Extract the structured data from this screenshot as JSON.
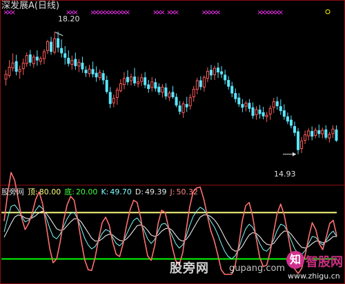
{
  "title": "深发展A(日线)",
  "high_label": "18.20",
  "low_label": "14.93",
  "indicator": {
    "name": "股旁网",
    "top_label": "顶:",
    "top_value": "80.00",
    "bottom_label": "底:",
    "bottom_value": "20.00",
    "k_label": "K:",
    "k_value": "49.70",
    "d_label": "D:",
    "d_value": "49.39",
    "j_label": "J:",
    "j_value": "50.32"
  },
  "watermark": "股旁网",
  "watermark_url": "gupang.com",
  "logo_char": "知",
  "logo_text": "智股网",
  "logo_url": "www.zhigu.cn",
  "colors": {
    "up": "#ff5a5a",
    "down": "#5ae6ff",
    "marker": "#ff33ff",
    "top_line": "#ffff80",
    "bottom_line": "#00ff00",
    "k_line": "#ff7070",
    "d_line": "#80ffff",
    "j_line": "#ffffff"
  },
  "chart_data": [
    {
      "type": "candlestick",
      "title": "深发展A(日线)",
      "ylim": [
        14.3,
        18.6
      ],
      "annotations": [
        {
          "text": "18.20",
          "value": 18.2
        },
        {
          "text": "14.93",
          "value": 14.93
        }
      ],
      "ohlc": [
        [
          16.93,
          17.18,
          16.76,
          17.06
        ],
        [
          17.03,
          17.44,
          16.97,
          17.25
        ],
        [
          17.23,
          17.62,
          17.14,
          17.36
        ],
        [
          17.4,
          17.58,
          17.03,
          17.14
        ],
        [
          17.13,
          17.29,
          16.94,
          17.19
        ],
        [
          17.21,
          17.48,
          17.04,
          17.36
        ],
        [
          17.35,
          17.64,
          17.26,
          17.56
        ],
        [
          17.58,
          17.71,
          17.28,
          17.38
        ],
        [
          17.34,
          17.59,
          17.23,
          17.52
        ],
        [
          17.52,
          17.7,
          17.29,
          17.44
        ],
        [
          17.41,
          17.54,
          17.31,
          17.48
        ],
        [
          17.48,
          17.73,
          17.33,
          17.66
        ],
        [
          17.69,
          17.98,
          17.6,
          17.93
        ],
        [
          17.92,
          18.06,
          17.58,
          17.67
        ],
        [
          17.65,
          18.2,
          17.59,
          18.01
        ],
        [
          18.01,
          18.2,
          17.65,
          17.78
        ],
        [
          17.75,
          17.99,
          17.51,
          17.63
        ],
        [
          17.61,
          17.81,
          17.32,
          17.51
        ],
        [
          17.49,
          17.7,
          17.27,
          17.35
        ],
        [
          17.32,
          17.56,
          17.18,
          17.43
        ],
        [
          17.46,
          17.64,
          17.18,
          17.29
        ],
        [
          17.28,
          17.47,
          17.12,
          17.38
        ],
        [
          17.36,
          17.53,
          17.1,
          17.2
        ],
        [
          17.17,
          17.28,
          16.99,
          17.1
        ],
        [
          17.08,
          17.31,
          16.99,
          17.2
        ],
        [
          17.19,
          17.4,
          16.98,
          17.07
        ],
        [
          17.09,
          17.27,
          16.86,
          16.99
        ],
        [
          16.97,
          17.19,
          16.9,
          17.11
        ],
        [
          17.08,
          17.17,
          16.79,
          16.91
        ],
        [
          16.9,
          17.02,
          16.54,
          16.6
        ],
        [
          16.58,
          16.72,
          16.16,
          16.28
        ],
        [
          16.3,
          16.52,
          16.18,
          16.42
        ],
        [
          16.44,
          16.71,
          16.25,
          16.64
        ],
        [
          16.62,
          16.93,
          16.58,
          16.81
        ],
        [
          16.79,
          17.12,
          16.66,
          16.95
        ],
        [
          16.98,
          17.17,
          16.77,
          16.86
        ],
        [
          16.89,
          17.08,
          16.76,
          16.99
        ],
        [
          16.99,
          17.23,
          16.75,
          16.83
        ],
        [
          16.81,
          17.0,
          16.71,
          16.86
        ],
        [
          16.87,
          17.08,
          16.75,
          16.97
        ],
        [
          16.97,
          17.12,
          16.69,
          16.78
        ],
        [
          16.78,
          16.91,
          16.57,
          16.68
        ],
        [
          16.71,
          16.99,
          16.6,
          16.86
        ],
        [
          16.84,
          16.95,
          16.6,
          16.69
        ],
        [
          16.72,
          16.82,
          16.51,
          16.59
        ],
        [
          16.58,
          16.8,
          16.44,
          16.72
        ],
        [
          16.7,
          16.82,
          16.39,
          16.48
        ],
        [
          16.45,
          16.62,
          16.35,
          16.56
        ],
        [
          16.58,
          16.75,
          16.41,
          16.46
        ],
        [
          16.45,
          16.55,
          16.18,
          16.24
        ],
        [
          16.22,
          16.35,
          15.99,
          16.07
        ],
        [
          16.04,
          16.34,
          15.9,
          16.27
        ],
        [
          16.26,
          16.46,
          16.06,
          16.19
        ],
        [
          16.22,
          16.53,
          16.12,
          16.44
        ],
        [
          16.46,
          16.75,
          16.33,
          16.66
        ],
        [
          16.66,
          16.97,
          16.53,
          16.89
        ],
        [
          16.89,
          17.01,
          16.64,
          16.73
        ],
        [
          16.72,
          17.03,
          16.6,
          16.98
        ],
        [
          16.95,
          17.25,
          16.85,
          17.14
        ],
        [
          17.17,
          17.31,
          16.91,
          17.04
        ],
        [
          17.05,
          17.29,
          16.91,
          17.22
        ],
        [
          17.23,
          17.37,
          16.96,
          17.12
        ],
        [
          17.13,
          17.28,
          16.96,
          17.07
        ],
        [
          17.04,
          17.18,
          16.79,
          16.91
        ],
        [
          16.9,
          17.01,
          16.65,
          16.74
        ],
        [
          16.74,
          16.86,
          16.45,
          16.56
        ],
        [
          16.55,
          16.68,
          16.31,
          16.41
        ],
        [
          16.43,
          16.56,
          16.19,
          16.27
        ],
        [
          16.26,
          16.4,
          16.05,
          16.18
        ],
        [
          16.21,
          16.35,
          16.07,
          16.29
        ],
        [
          16.29,
          16.4,
          16.05,
          16.15
        ],
        [
          16.17,
          16.31,
          15.87,
          15.96
        ],
        [
          15.98,
          16.21,
          15.85,
          16.12
        ],
        [
          16.11,
          16.24,
          15.88,
          16.01
        ],
        [
          16.04,
          16.19,
          15.86,
          15.95
        ],
        [
          15.93,
          16.06,
          15.79,
          15.97
        ],
        [
          16.0,
          16.23,
          15.85,
          16.15
        ],
        [
          16.18,
          16.43,
          16.03,
          16.33
        ],
        [
          16.33,
          16.46,
          16.12,
          16.22
        ],
        [
          16.2,
          16.39,
          15.98,
          16.09
        ],
        [
          16.09,
          16.26,
          15.85,
          15.94
        ],
        [
          15.93,
          16.04,
          15.73,
          15.81
        ],
        [
          15.84,
          15.96,
          15.62,
          15.7
        ],
        [
          15.67,
          15.8,
          15.41,
          15.51
        ],
        [
          15.53,
          15.63,
          14.93,
          15.05
        ],
        [
          15.08,
          15.39,
          14.96,
          15.28
        ],
        [
          15.3,
          15.56,
          15.2,
          15.45
        ],
        [
          15.42,
          15.62,
          15.3,
          15.55
        ],
        [
          15.54,
          15.67,
          15.3,
          15.41
        ],
        [
          15.43,
          15.64,
          15.36,
          15.57
        ],
        [
          15.56,
          15.72,
          15.37,
          15.48
        ],
        [
          15.47,
          15.64,
          15.35,
          15.57
        ],
        [
          15.58,
          15.7,
          15.32,
          15.38
        ],
        [
          15.36,
          15.52,
          15.24,
          15.46
        ],
        [
          15.48,
          15.7,
          15.36,
          15.6
        ],
        [
          15.58,
          15.7,
          15.26,
          15.3
        ]
      ],
      "markers": [
        {
          "label": "×",
          "start": 0,
          "end": 2
        },
        {
          "label": "×",
          "start": 18,
          "end": 20
        },
        {
          "label": "×",
          "start": 25,
          "end": 35
        },
        {
          "label": "×",
          "start": 43,
          "end": 45
        },
        {
          "label": "×",
          "start": 47,
          "end": 49
        },
        {
          "label": "×",
          "start": 57,
          "end": 61
        },
        {
          "label": "×",
          "start": 73,
          "end": 79
        }
      ]
    },
    {
      "type": "line",
      "title": "股旁网",
      "ylim": [
        0,
        100
      ],
      "reference_lines": [
        {
          "name": "顶",
          "value": 80
        },
        {
          "name": "底",
          "value": 20
        }
      ],
      "series": [
        {
          "name": "K",
          "values": [
            55,
            73,
            88,
            90,
            84,
            75,
            68,
            70,
            75,
            83,
            89,
            85,
            74,
            60,
            49,
            46,
            52,
            62,
            72,
            79,
            80,
            72,
            60,
            47,
            38,
            33,
            36,
            44,
            53,
            58,
            56,
            48,
            40,
            37,
            42,
            52,
            62,
            70,
            73,
            67,
            57,
            46,
            40,
            45,
            56,
            65,
            66,
            60,
            50,
            40,
            34,
            38,
            49,
            63,
            75,
            82,
            87,
            84,
            77,
            69,
            62,
            52,
            40,
            30,
            23,
            20,
            24,
            33,
            47,
            59,
            65,
            61,
            51,
            40,
            32,
            30,
            35,
            45,
            57,
            65,
            63,
            55,
            44,
            33,
            27,
            26,
            31,
            40,
            49,
            48,
            42,
            38,
            44,
            52,
            56,
            49
          ]
        },
        {
          "name": "D",
          "values": [
            48,
            57,
            66,
            74,
            77,
            76,
            73,
            72,
            73,
            76,
            80,
            82,
            79,
            73,
            66,
            59,
            57,
            58,
            63,
            68,
            72,
            72,
            68,
            61,
            54,
            47,
            43,
            43,
            46,
            50,
            52,
            51,
            47,
            44,
            43,
            46,
            51,
            57,
            63,
            64,
            62,
            57,
            51,
            49,
            51,
            56,
            59,
            60,
            57,
            51,
            45,
            43,
            45,
            51,
            59,
            67,
            74,
            77,
            77,
            75,
            71,
            65,
            57,
            48,
            40,
            33,
            30,
            31,
            36,
            44,
            51,
            54,
            53,
            49,
            43,
            39,
            38,
            40,
            46,
            52,
            56,
            56,
            52,
            46,
            40,
            35,
            34,
            36,
            40,
            43,
            43,
            41,
            42,
            45,
            49,
            49
          ]
        },
        {
          "name": "J",
          "values": [
            69,
            105,
            132,
            122,
            98,
            73,
            58,
            66,
            79,
            97,
            107,
            91,
            64,
            34,
            15,
            20,
            42,
            70,
            90,
            101,
            96,
            72,
            44,
            19,
            6,
            5,
            22,
            46,
            67,
            74,
            64,
            42,
            26,
            23,
            40,
            64,
            84,
            96,
            93,
            73,
            47,
            24,
            18,
            37,
            66,
            83,
            80,
            60,
            36,
            18,
            12,
            28,
            57,
            87,
            107,
            112,
            113,
            98,
            77,
            57,
            44,
            26,
            6,
            0,
            0,
            0,
            12,
            37,
            69,
            89,
            93,
            75,
            47,
            22,
            10,
            12,
            29,
            55,
            79,
            91,
            77,
            53,
            28,
            7,
            1,
            8,
            25,
            48,
            67,
            58,
            40,
            32,
            48,
            66,
            70,
            50
          ]
        }
      ]
    }
  ]
}
